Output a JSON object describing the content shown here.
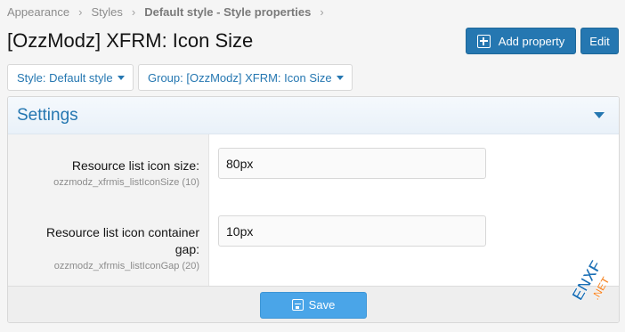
{
  "breadcrumb": {
    "items": [
      "Appearance",
      "Styles",
      "Default style - Style properties"
    ],
    "separator": "›"
  },
  "page": {
    "title": "[OzzModz] XFRM: Icon Size"
  },
  "header_actions": {
    "add_label": "Add property",
    "edit_label": "Edit",
    "add_icon": "plus-square-icon"
  },
  "filters": {
    "style_label": "Style: Default style",
    "group_label": "Group: [OzzModz] XFRM: Icon Size"
  },
  "panel": {
    "title": "Settings",
    "fields": [
      {
        "label": "Resource list icon size:",
        "hint": "ozzmodz_xfrmis_listIconSize (10)",
        "value": "80px"
      },
      {
        "label": "Resource list icon container gap:",
        "hint": "ozzmodz_xfrmis_listIconGap (20)",
        "value": "10px"
      }
    ],
    "save_label": "Save",
    "save_icon": "floppy-disk-icon"
  },
  "watermark": {
    "text": "ENXF.NET"
  },
  "colors": {
    "accent": "#2577b1",
    "save_button": "#4aa5e8",
    "watermark_orange": "#f58220",
    "watermark_blue": "#1b6fb5"
  }
}
